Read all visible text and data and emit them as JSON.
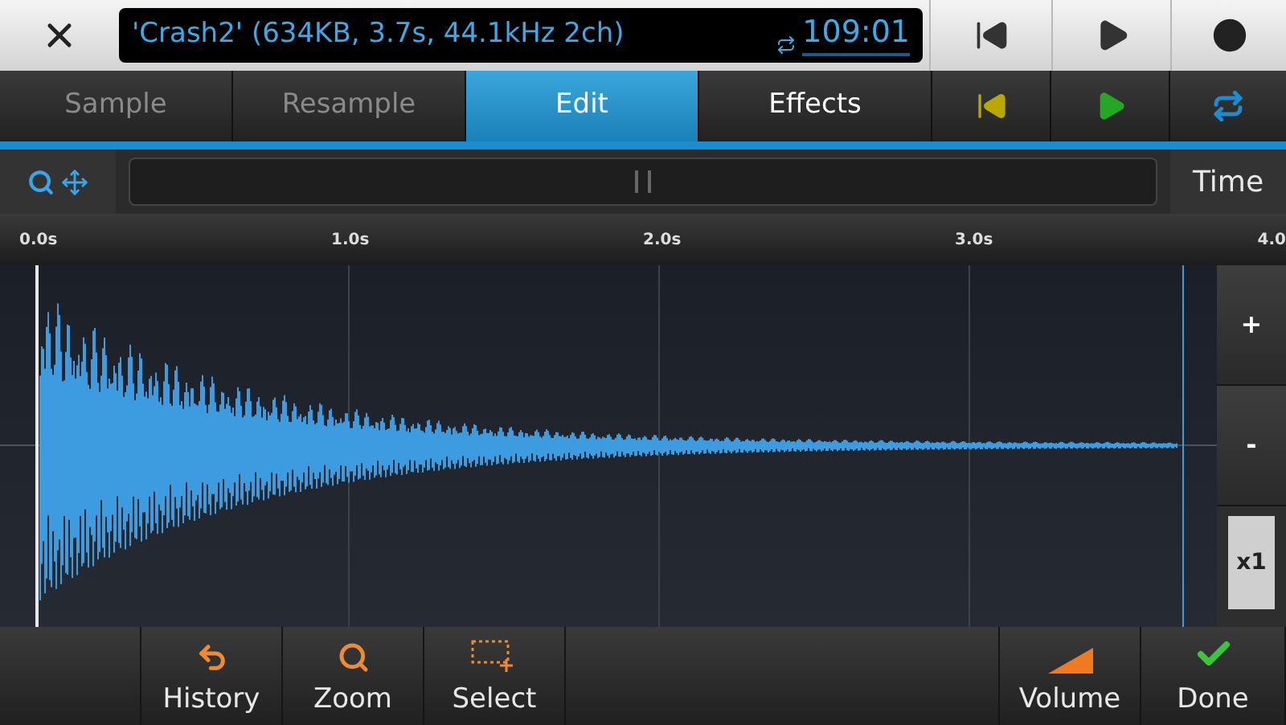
{
  "header": {
    "file_info": "'Crash2' (634KB, 3.7s, 44.1kHz 2ch)",
    "time": "109:01"
  },
  "tabs": [
    {
      "label": "Sample",
      "selected": false,
      "disabled": true
    },
    {
      "label": "Resample",
      "selected": false,
      "disabled": true
    },
    {
      "label": "Edit",
      "selected": true,
      "disabled": false
    },
    {
      "label": "Effects",
      "selected": false,
      "disabled": false
    }
  ],
  "time_button": "Time",
  "ruler": [
    "0.0s",
    "1.0s",
    "2.0s",
    "3.0s",
    "4.0"
  ],
  "zoom_buttons": [
    "+",
    "-",
    "x1"
  ],
  "bottom_tools": [
    {
      "kind": "history",
      "label": "History"
    },
    {
      "kind": "zoom",
      "label": "Zoom"
    },
    {
      "kind": "select",
      "label": "Select"
    },
    {
      "kind": "spacer"
    },
    {
      "kind": "volume",
      "label": "Volume"
    },
    {
      "kind": "done",
      "label": "Done"
    }
  ]
}
